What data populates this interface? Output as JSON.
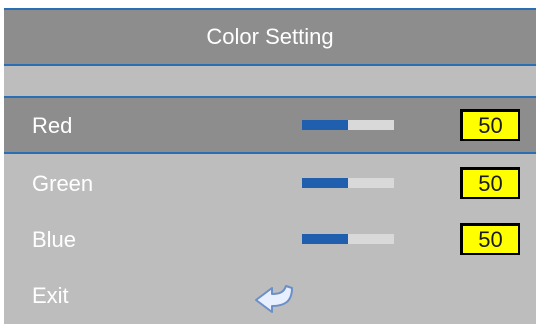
{
  "window": {
    "title": "Color Setting"
  },
  "settings": [
    {
      "label": "Red",
      "value": "50",
      "level": 0.5
    },
    {
      "label": "Green",
      "value": "50",
      "level": 0.5
    },
    {
      "label": "Blue",
      "value": "50",
      "level": 0.5
    }
  ],
  "exit": {
    "label": "Exit",
    "icon": "return-arrow-icon"
  },
  "colors": {
    "accent": "#2a6fb4",
    "bar_fill": "#1f5fae",
    "value_box": "#ffff00"
  },
  "selected_item": "Red"
}
